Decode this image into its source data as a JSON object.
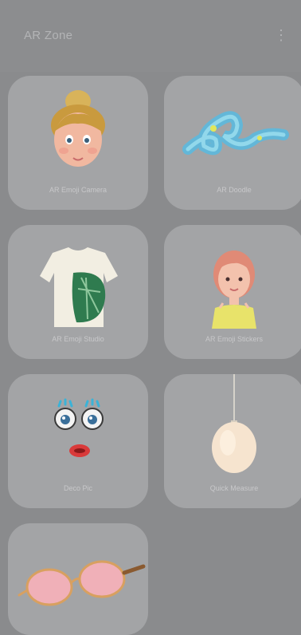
{
  "header": {
    "title": "AR Zone",
    "more_icon": "vertical-dots-icon"
  },
  "tiles": [
    {
      "label": "AR Emoji Camera",
      "icon": "ar-emoji-camera-icon"
    },
    {
      "label": "AR Doodle",
      "icon": "ar-doodle-icon"
    },
    {
      "label": "AR Emoji Studio",
      "icon": "ar-emoji-studio-icon"
    },
    {
      "label": "AR Emoji Stickers",
      "icon": "ar-emoji-stickers-icon"
    },
    {
      "label": "Deco Pic",
      "icon": "deco-pic-icon"
    },
    {
      "label": "Quick Measure",
      "icon": "quick-measure-icon"
    },
    {
      "label": "",
      "icon": "sunglasses-icon"
    }
  ]
}
